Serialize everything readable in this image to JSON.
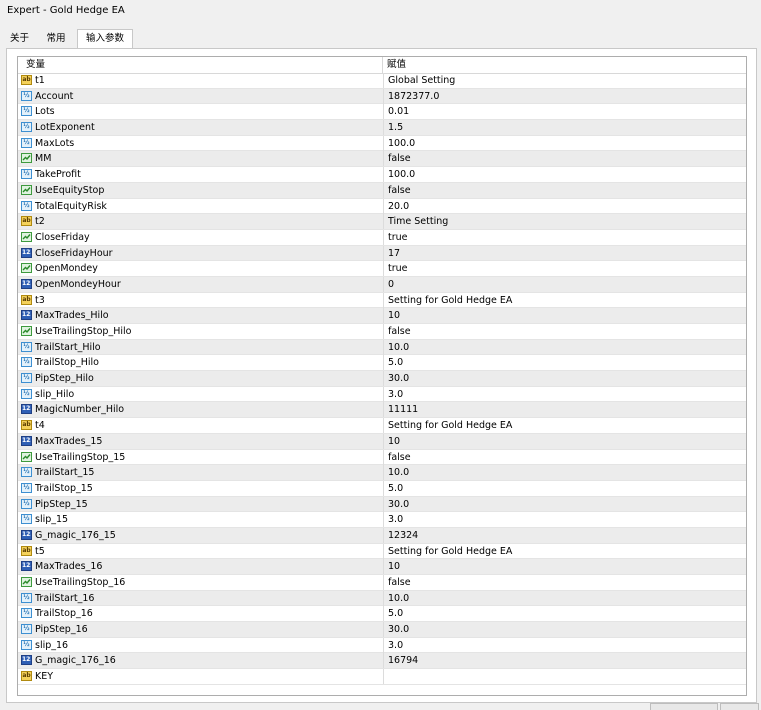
{
  "window": {
    "title": "Expert - Gold Hedge EA"
  },
  "tabs": [
    {
      "label": "关于"
    },
    {
      "label": "常用"
    },
    {
      "label": "输入参数"
    }
  ],
  "grid": {
    "columns": [
      "变量",
      "赋值"
    ],
    "rows": [
      {
        "name": "t1",
        "value": "Global Setting",
        "icon": "string-icon"
      },
      {
        "name": "Account",
        "value": "1872377.0",
        "icon": "double-icon"
      },
      {
        "name": "Lots",
        "value": "0.01",
        "icon": "double-icon"
      },
      {
        "name": "LotExponent",
        "value": "1.5",
        "icon": "double-icon"
      },
      {
        "name": "MaxLots",
        "value": "100.0",
        "icon": "double-icon"
      },
      {
        "name": "MM",
        "value": "false",
        "icon": "bool-icon"
      },
      {
        "name": "TakeProfit",
        "value": "100.0",
        "icon": "double-icon"
      },
      {
        "name": "UseEquityStop",
        "value": "false",
        "icon": "bool-icon"
      },
      {
        "name": "TotalEquityRisk",
        "value": "20.0",
        "icon": "double-icon"
      },
      {
        "name": "t2",
        "value": "Time Setting",
        "icon": "string-icon"
      },
      {
        "name": "CloseFriday",
        "value": "true",
        "icon": "bool-icon"
      },
      {
        "name": "CloseFridayHour",
        "value": "17",
        "icon": "int-icon"
      },
      {
        "name": "OpenMondey",
        "value": "true",
        "icon": "bool-icon"
      },
      {
        "name": "OpenMondeyHour",
        "value": "0",
        "icon": "int-icon"
      },
      {
        "name": "t3",
        "value": "Setting for Gold Hedge EA",
        "icon": "string-icon"
      },
      {
        "name": "MaxTrades_Hilo",
        "value": "10",
        "icon": "int-icon"
      },
      {
        "name": "UseTrailingStop_Hilo",
        "value": "false",
        "icon": "bool-icon"
      },
      {
        "name": "TrailStart_Hilo",
        "value": "10.0",
        "icon": "double-icon"
      },
      {
        "name": "TrailStop_Hilo",
        "value": "5.0",
        "icon": "double-icon"
      },
      {
        "name": "PipStep_Hilo",
        "value": "30.0",
        "icon": "double-icon"
      },
      {
        "name": "slip_Hilo",
        "value": "3.0",
        "icon": "double-icon"
      },
      {
        "name": "MagicNumber_Hilo",
        "value": "11111",
        "icon": "int-icon"
      },
      {
        "name": "t4",
        "value": "Setting for Gold Hedge EA",
        "icon": "string-icon"
      },
      {
        "name": "MaxTrades_15",
        "value": "10",
        "icon": "int-icon"
      },
      {
        "name": "UseTrailingStop_15",
        "value": "false",
        "icon": "bool-icon"
      },
      {
        "name": "TrailStart_15",
        "value": "10.0",
        "icon": "double-icon"
      },
      {
        "name": "TrailStop_15",
        "value": "5.0",
        "icon": "double-icon"
      },
      {
        "name": "PipStep_15",
        "value": "30.0",
        "icon": "double-icon"
      },
      {
        "name": "slip_15",
        "value": "3.0",
        "icon": "double-icon"
      },
      {
        "name": "G_magic_176_15",
        "value": "12324",
        "icon": "int-icon"
      },
      {
        "name": "t5",
        "value": "Setting for Gold Hedge EA",
        "icon": "string-icon"
      },
      {
        "name": "MaxTrades_16",
        "value": "10",
        "icon": "int-icon"
      },
      {
        "name": "UseTrailingStop_16",
        "value": "false",
        "icon": "bool-icon"
      },
      {
        "name": "TrailStart_16",
        "value": "10.0",
        "icon": "double-icon"
      },
      {
        "name": "TrailStop_16",
        "value": "5.0",
        "icon": "double-icon"
      },
      {
        "name": "PipStep_16",
        "value": "30.0",
        "icon": "double-icon"
      },
      {
        "name": "slip_16",
        "value": "3.0",
        "icon": "double-icon"
      },
      {
        "name": "G_magic_176_16",
        "value": "16794",
        "icon": "int-icon"
      },
      {
        "name": "KEY",
        "value": "",
        "icon": "string-icon"
      }
    ]
  }
}
